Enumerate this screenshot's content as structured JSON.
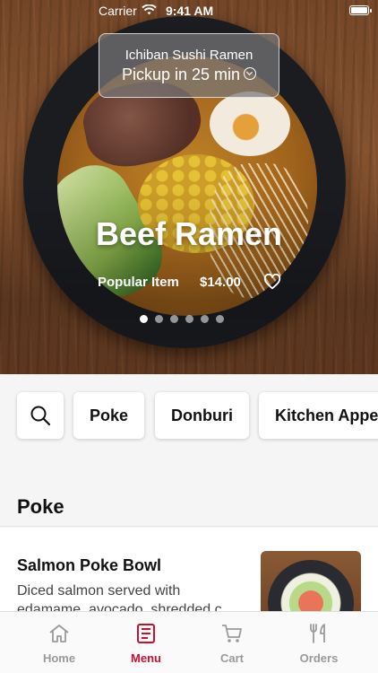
{
  "status_bar": {
    "carrier": "Carrier",
    "time": "9:41 AM"
  },
  "restaurant": {
    "name": "Ichiban Sushi Ramen",
    "pickup": "Pickup in 25 min"
  },
  "featured": {
    "title": "Beef Ramen",
    "tag": "Popular Item",
    "price": "$14.00",
    "carousel_active_index": 0,
    "carousel_count": 6
  },
  "categories": [
    "Poke",
    "Donburi",
    "Kitchen Appe"
  ],
  "section": {
    "title": "Poke"
  },
  "menu_items": [
    {
      "name": "Salmon Poke Bowl",
      "description": "Diced salmon served with edamame, avocado, shredded c..."
    }
  ],
  "tabs": [
    {
      "label": "Home",
      "icon": "home-icon"
    },
    {
      "label": "Menu",
      "icon": "menu-icon"
    },
    {
      "label": "Cart",
      "icon": "cart-icon"
    },
    {
      "label": "Orders",
      "icon": "orders-icon"
    }
  ],
  "colors": {
    "accent": "#c8102e",
    "inactive": "#9a9a9a"
  }
}
